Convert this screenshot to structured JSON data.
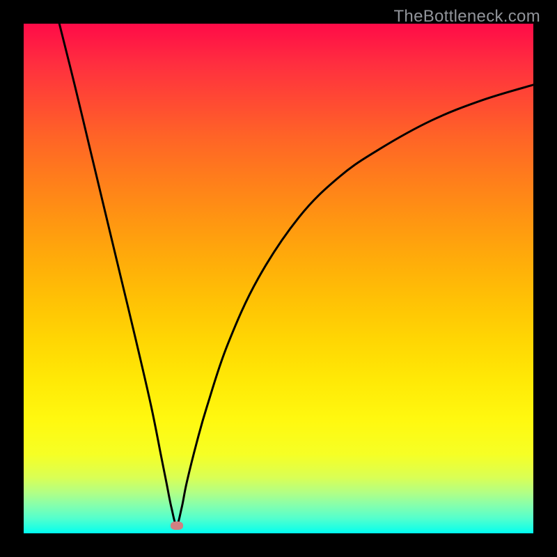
{
  "watermark": "TheBottleneck.com",
  "chart_data": {
    "type": "line",
    "title": "",
    "xlabel": "",
    "ylabel": "",
    "xlim": [
      0,
      100
    ],
    "ylim": [
      0,
      100
    ],
    "grid": false,
    "marker": {
      "x_pct": 30,
      "y_pct": 98.5
    },
    "x": [
      7,
      10,
      13,
      16,
      19,
      22,
      25,
      27,
      28,
      29,
      30,
      31,
      32,
      34,
      36,
      40,
      46,
      54,
      62,
      70,
      80,
      90,
      100
    ],
    "y": [
      0,
      12,
      24.5,
      37,
      49.5,
      62,
      75,
      85,
      90,
      95,
      98.3,
      95,
      90,
      82,
      75,
      63,
      50,
      38,
      30,
      24.5,
      19,
      15,
      12
    ],
    "series": [
      {
        "name": "bottleneck-curve",
        "x": "shared",
        "y": "shared"
      }
    ],
    "background_gradient_stops": [
      {
        "pct": 0,
        "color": "#ff0b48"
      },
      {
        "pct": 8,
        "color": "#ff2f3f"
      },
      {
        "pct": 15,
        "color": "#ff4933"
      },
      {
        "pct": 22,
        "color": "#ff6327"
      },
      {
        "pct": 30,
        "color": "#ff7c1c"
      },
      {
        "pct": 38,
        "color": "#ff9412"
      },
      {
        "pct": 46,
        "color": "#ffab0a"
      },
      {
        "pct": 54,
        "color": "#ffc105"
      },
      {
        "pct": 62,
        "color": "#ffd603"
      },
      {
        "pct": 70,
        "color": "#ffe906"
      },
      {
        "pct": 78,
        "color": "#fff910"
      },
      {
        "pct": 84.5,
        "color": "#f6ff25"
      },
      {
        "pct": 89,
        "color": "#daff54"
      },
      {
        "pct": 92,
        "color": "#b2ff85"
      },
      {
        "pct": 94.5,
        "color": "#85ffad"
      },
      {
        "pct": 97,
        "color": "#55ffcc"
      },
      {
        "pct": 99,
        "color": "#1fffe3"
      },
      {
        "pct": 100,
        "color": "#00fff2"
      }
    ]
  }
}
